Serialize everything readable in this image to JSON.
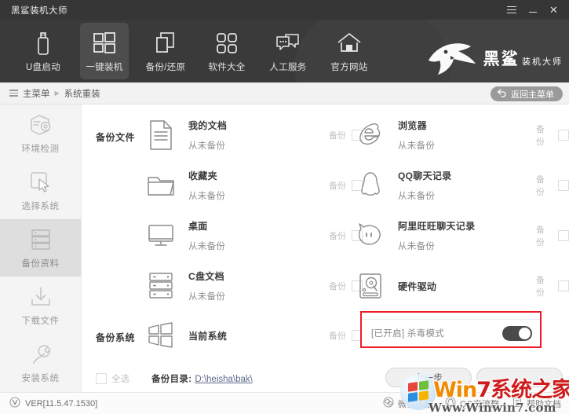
{
  "window": {
    "title": "黑鲨装机大师",
    "controls": [
      {
        "name": "menu-button",
        "icon": "hamburger-icon"
      },
      {
        "name": "minimize-button",
        "icon": "minimize-icon"
      },
      {
        "name": "close-button",
        "icon": "close-icon",
        "glyph": "✕"
      }
    ]
  },
  "nav": {
    "items": [
      {
        "label": "U盘启动",
        "icon": "usb-drive-icon",
        "active": false
      },
      {
        "label": "一键装机",
        "icon": "windows-grid-icon",
        "active": true
      },
      {
        "label": "备份/还原",
        "icon": "copy-layers-icon",
        "active": false
      },
      {
        "label": "软件大全",
        "icon": "four-squares-icon",
        "active": false
      },
      {
        "label": "人工服务",
        "icon": "chat-bubbles-icon",
        "active": false
      },
      {
        "label": "官方网站",
        "icon": "home-icon",
        "active": false
      }
    ],
    "brand_main": "黑鲨",
    "brand_sub": "装机大师",
    "brand_logo": "shark-logo-icon"
  },
  "breadcrumb": {
    "menu_icon": "list-menu-icon",
    "root": "主菜单",
    "separator": "▶",
    "current": "系统重装",
    "back_button": "返回主菜单",
    "back_icon": "back-arrow-icon"
  },
  "sidebar": {
    "items": [
      {
        "label": "环境检测",
        "icon": "environment-check-icon",
        "active": false
      },
      {
        "label": "选择系统",
        "icon": "cursor-select-icon",
        "active": false
      },
      {
        "label": "备份资料",
        "icon": "server-stack-icon",
        "active": true
      },
      {
        "label": "下载文件",
        "icon": "download-icon",
        "active": false
      },
      {
        "label": "安装系统",
        "icon": "wrench-icon",
        "active": false
      }
    ]
  },
  "main": {
    "section_files_label": "备份文件",
    "section_system_label": "备份系统",
    "backup_checkbox_label": "备份",
    "never_backed_up": "从未备份",
    "files_left": [
      {
        "title": "我的文档",
        "sub": "从未备份",
        "icon": "document-icon",
        "checked": false
      },
      {
        "title": "收藏夹",
        "sub": "从未备份",
        "icon": "folder-icon",
        "checked": false
      },
      {
        "title": "桌面",
        "sub": "从未备份",
        "icon": "monitor-icon",
        "checked": false
      },
      {
        "title": "C盘文档",
        "sub": "从未备份",
        "icon": "server-stack-icon",
        "checked": false
      }
    ],
    "files_right": [
      {
        "title": "浏览器",
        "sub": "从未备份",
        "icon": "internet-explorer-icon",
        "checked": false
      },
      {
        "title": "QQ聊天记录",
        "sub": "从未备份",
        "icon": "qq-penguin-icon",
        "checked": false
      },
      {
        "title": "阿里旺旺聊天记录",
        "sub": "从未备份",
        "icon": "aliwangwang-icon",
        "checked": false
      },
      {
        "title": "硬件驱动",
        "sub": "",
        "icon": "hard-drive-icon",
        "checked": false
      }
    ],
    "system_row": {
      "title": "当前系统",
      "sub": "",
      "icon": "windows-grid-icon",
      "checked": false
    },
    "antivirus": {
      "status": "[已开启]",
      "label": "杀毒模式",
      "full_text": "[已开启] 杀毒模式",
      "enabled": true,
      "highlight_color": "#ee1c25"
    }
  },
  "actionbar": {
    "select_all_label": "全选",
    "select_all_checked": false,
    "backup_dir_label": "备份目录:",
    "backup_dir_value": "D:\\heisha\\bak\\",
    "prev_button": "上一步"
  },
  "footer": {
    "version_icon": "version-badge-icon",
    "version": "VER[11.5.47.1530]",
    "links": [
      {
        "label": "微信客服",
        "icon": "wechat-icon"
      },
      {
        "label": "QQ交流群",
        "icon": "qq-icon"
      },
      {
        "label": "帮助文档",
        "icon": "document-icon"
      }
    ]
  },
  "watermark": {
    "line1_a": "W",
    "line1_b": "in",
    "line1_c": "7",
    "line1_d": "系统之家",
    "line2": "Www.Winwin7.com",
    "logo": "windows-flag-icon"
  }
}
